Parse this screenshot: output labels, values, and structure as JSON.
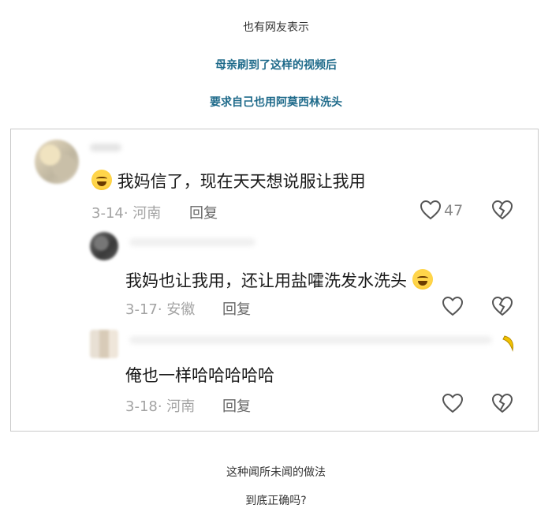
{
  "captions": {
    "line1": "也有网友表示",
    "line2": "母亲刷到了这样的视频后",
    "line3": "要求自己也用阿莫西林洗头",
    "line4": "这种闻所未闻的做法",
    "line5": "到底正确吗?"
  },
  "colors": {
    "caption_highlight": "#1e6a8a",
    "meta_gray": "#a3a3a3"
  },
  "comments": [
    {
      "text": "我妈信了，现在天天想说服让我用",
      "date_location": "3-14· 河南",
      "reply_label": "回复",
      "likes": "47",
      "emoji": "grinning-sweat-emoji"
    },
    {
      "text": "我妈也让我用，还让用盐嚯洗发水洗头",
      "date_location": "3-17· 安徽",
      "reply_label": "回复",
      "likes": "",
      "emoji": "crying-laughing-emoji"
    },
    {
      "text": "俺也一样哈哈哈哈哈",
      "date_location": "3-18· 河南",
      "reply_label": "回复",
      "likes": ""
    }
  ]
}
